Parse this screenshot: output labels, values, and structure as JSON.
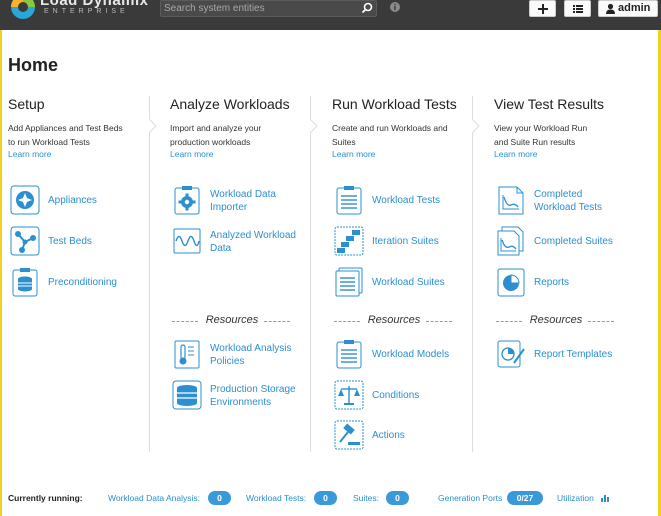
{
  "brand": {
    "name": "Load Dynamix",
    "sub": "ENTERPRISE"
  },
  "search": {
    "placeholder": "Search system entities"
  },
  "user": {
    "name": "admin"
  },
  "page": {
    "title": "Home"
  },
  "columns": [
    {
      "title": "Setup",
      "desc1": "Add Appliances and Test Beds",
      "desc2": "to run Workload Tests",
      "learn": "Learn more",
      "items": [
        {
          "l1": "Appliances",
          "icon": "appliance-icon"
        },
        {
          "l1": "Test Beds",
          "icon": "testbed-icon"
        },
        {
          "l1": "Preconditioning",
          "icon": "precondition-icon"
        }
      ]
    },
    {
      "title": "Analyze Workloads",
      "desc1": "Import and analyze your",
      "desc2": "production workloads",
      "learn": "Learn more",
      "items": [
        {
          "l1": "Workload Data",
          "l2": "Importer",
          "icon": "gear-doc-icon"
        },
        {
          "l1": "Analyzed Workload",
          "l2": "Data",
          "icon": "waveform-icon"
        }
      ],
      "resources_label": "Resources",
      "resources": [
        {
          "l1": "Workload Analysis",
          "l2": "Policies",
          "icon": "thermometer-icon"
        },
        {
          "l1": "Production Storage",
          "l2": "Environments",
          "icon": "storage-icon"
        }
      ]
    },
    {
      "title": "Run Workload Tests",
      "desc1": "Create and run Workloads and",
      "desc2": "Suites",
      "learn": "Learn more",
      "items": [
        {
          "l1": "Workload Tests",
          "icon": "document-icon"
        },
        {
          "l1": "Iteration Suites",
          "icon": "steps-icon"
        },
        {
          "l1": "Workload Suites",
          "icon": "stack-doc-icon"
        }
      ],
      "resources_label": "Resources",
      "resources": [
        {
          "l1": "Workload Models",
          "icon": "model-doc-icon"
        },
        {
          "l1": "Conditions",
          "icon": "scale-icon"
        },
        {
          "l1": "Actions",
          "icon": "gavel-icon"
        }
      ]
    },
    {
      "title": "View Test Results",
      "desc1": "View your Workload Run",
      "desc2": "and Suite Run results",
      "learn": "Learn more",
      "items": [
        {
          "l1": "Completed",
          "l2": "Workload Tests",
          "icon": "chart-doc-icon"
        },
        {
          "l1": "Completed Suites",
          "icon": "chart-stack-icon"
        },
        {
          "l1": "Reports",
          "icon": "pie-doc-icon"
        }
      ],
      "resources_label": "Resources",
      "resources": [
        {
          "l1": "Report Templates",
          "icon": "template-icon"
        }
      ]
    }
  ],
  "footer": {
    "running": "Currently running:",
    "wda_label": "Workload Data Analysis:",
    "wda_value": "0",
    "wt_label": "Workload Tests:",
    "wt_value": "0",
    "suites_label": "Suites:",
    "suites_value": "0",
    "gp_label": "Generation Ports",
    "gp_value": "0/27",
    "util_label": "Utilization"
  },
  "colors": {
    "accent": "#2b8fd0",
    "topbar": "#3a3a3a",
    "frame": "#f0d020"
  }
}
